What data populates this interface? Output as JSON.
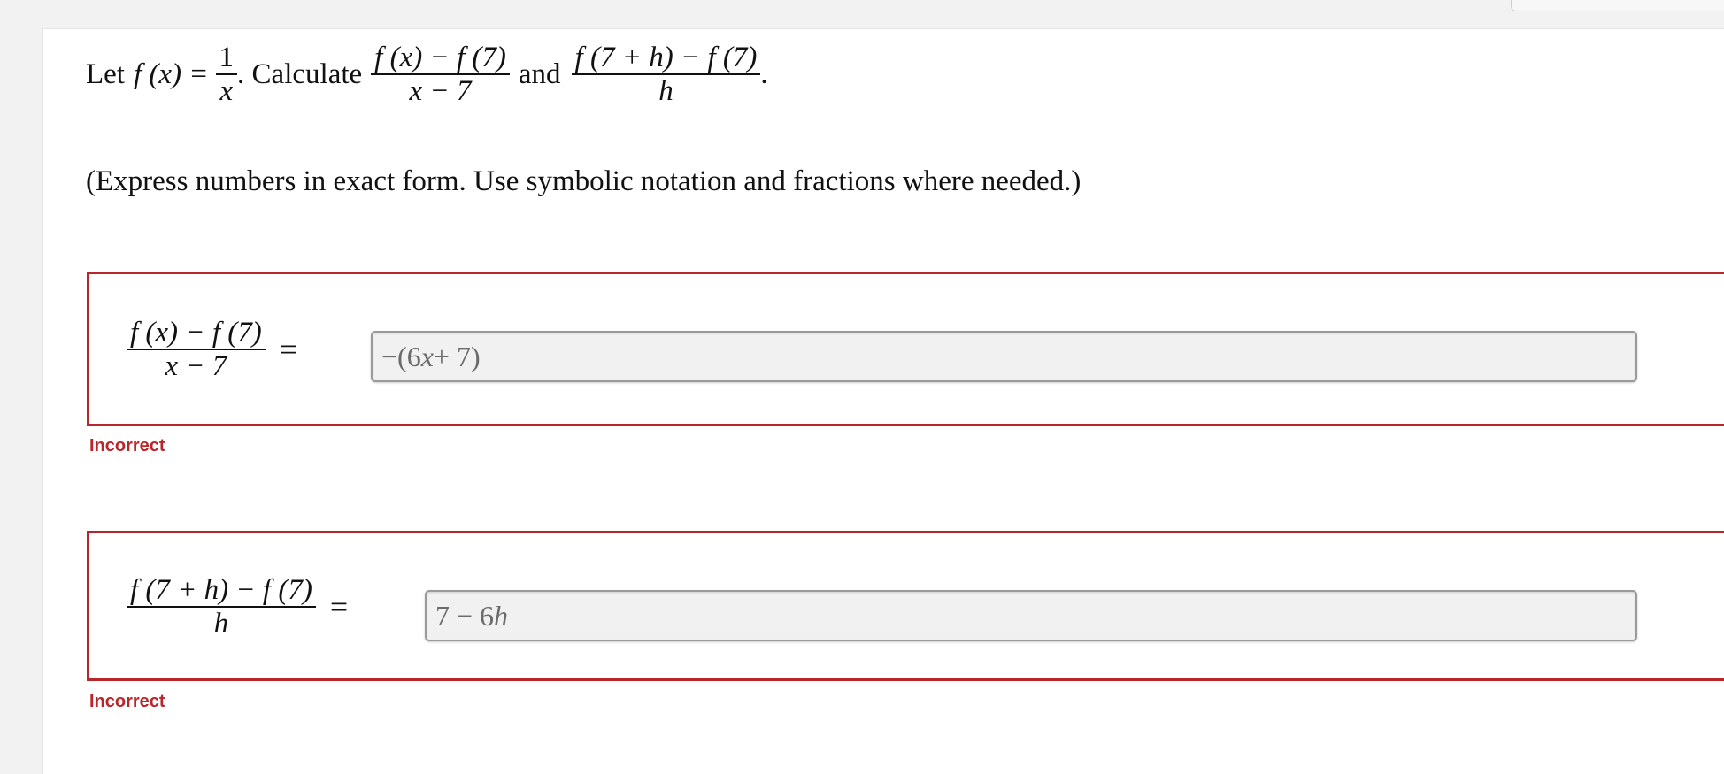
{
  "question": {
    "let": "Let",
    "f_of_x": "f (x) =",
    "def_num": "1",
    "def_den": "x",
    "calculate": ". Calculate",
    "expr1_num": "f (x) − f (7)",
    "expr1_den": "x − 7",
    "and": "and",
    "expr2_num": "f (7 + h) − f (7)",
    "expr2_den": "h",
    "period": "."
  },
  "instructions": "(Express numbers in exact form. Use symbolic notation and fractions where needed.)",
  "answers": [
    {
      "lhs_num": "f (x) − f (7)",
      "lhs_den": "x − 7",
      "eq": "=",
      "value_prefix": "−(6",
      "value_var": "x",
      "value_suffix": " + 7)",
      "status": "Incorrect"
    },
    {
      "lhs_num": "f (7 + h) − f (7)",
      "lhs_den": "h",
      "eq": "=",
      "value_prefix": "7 − 6",
      "value_var": "h",
      "value_suffix": "",
      "status": "Incorrect"
    }
  ],
  "colors": {
    "incorrect": "#b8262c",
    "input_bg": "#f1f1f1"
  }
}
